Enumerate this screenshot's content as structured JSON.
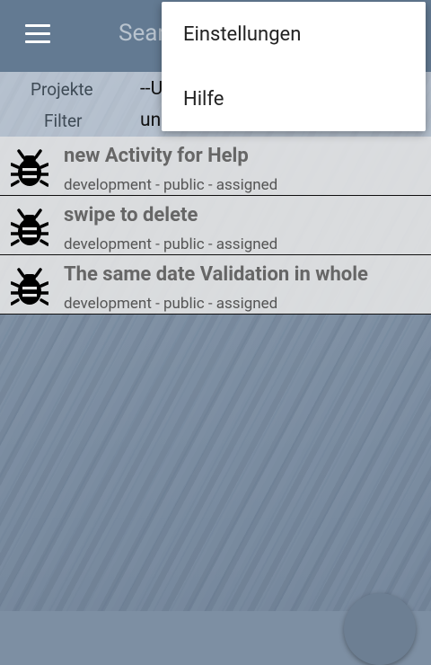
{
  "toolbar": {
    "menu_icon": "hamburger-icon",
    "search_hint": "Sear"
  },
  "filter": {
    "project_label": "Projekte",
    "project_value": "--U",
    "filter_label": "Filter",
    "filter_value": "un"
  },
  "issues": [
    {
      "icon": "bug-icon",
      "title": "new Activity for Help",
      "meta": "development - public - assigned"
    },
    {
      "icon": "bug-icon",
      "title": "swipe to delete",
      "meta": "development - public - assigned"
    },
    {
      "icon": "bug-icon",
      "title": "The same date Validation in whole",
      "meta": "development - public - assigned"
    }
  ],
  "overflow_menu": {
    "items": [
      {
        "label": "Einstellungen"
      },
      {
        "label": "Hilfe"
      }
    ]
  }
}
